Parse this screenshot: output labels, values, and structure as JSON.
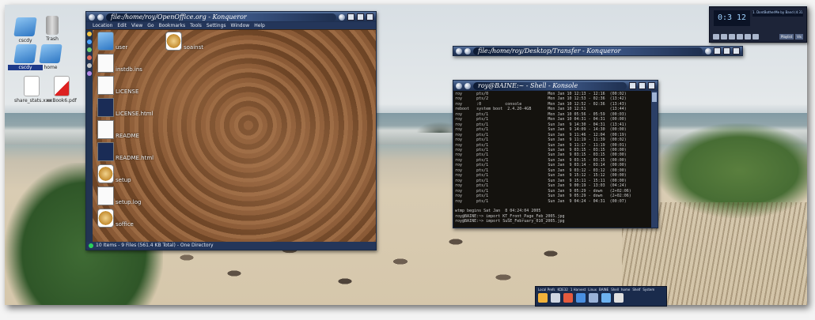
{
  "desktop": {
    "icons": [
      {
        "label": "cscdy",
        "icon": "folder-icon"
      },
      {
        "label": "Trash",
        "icon": "trash-icon"
      },
      {
        "label": "cscdy",
        "icon": "folder-icon"
      },
      {
        "label": "home",
        "icon": "folder-icon"
      },
      {
        "label": "share_stats.xxx",
        "icon": "document-icon"
      },
      {
        "label": "xxBook6.pdf",
        "icon": "pdf-icon"
      }
    ]
  },
  "konqueror_main": {
    "title": "file:/home/roy/OpenOffice.org - Konqueror",
    "menu": [
      "Location",
      "Edit",
      "View",
      "Go",
      "Bookmarks",
      "Tools",
      "Settings",
      "Window",
      "Help"
    ],
    "files": [
      {
        "name": "user",
        "thumb": "folder"
      },
      {
        "name": "soainst",
        "thumb": "tool"
      },
      {
        "name": "instdb.ins",
        "thumb": "doc"
      },
      {
        "name": "LICENSE",
        "thumb": "doc"
      },
      {
        "name": "LICENSE.html",
        "thumb": "dark"
      },
      {
        "name": "README",
        "thumb": "doc"
      },
      {
        "name": "README.html",
        "thumb": "dark"
      },
      {
        "name": "setup",
        "thumb": "tool"
      },
      {
        "name": "setup.log",
        "thumb": "doc"
      },
      {
        "name": "soffice",
        "thumb": "tool"
      }
    ],
    "status": "10 Items - 9 Files (561.4 KB Total) - One Directory"
  },
  "konqueror_second": {
    "title": "file:/home/roy/Desktop/Transfer - Konqueror"
  },
  "konsole": {
    "title": "roy@BAINE:~ - Shell - Konsole",
    "lines": [
      "roy      pts/0                         Mon Jan 10 12:13 - 12:16  (00:02)",
      "roy      pts/2                         Mon Jan 10 12:53 - 02:36  (13:42)",
      "roy      :0          console           Mon Jan 10 12:52 - 02:36  (13:43)",
      "reboot   system boot  2.4.20-4GB       Mon Jan 10 12:51          (13:44)",
      "roy      pts/1                         Mon Jan 10 05:56 - 05:59  (00:03)",
      "roy      pts/1                         Mon Jan 10 04:31 - 04:31  (00:00)",
      "roy      pts/1                         Sun Jan  9 14:30 - 04:31  (13:41)",
      "roy      pts/1                         Sun Jan  9 14:09 - 14:30  (00:00)",
      "roy      pts/1                         Sun Jan  9 11:46 - 12:04  (00:19)",
      "roy      pts/1                         Sun Jan  9 11:19 - 11:39  (00:02)",
      "roy      pts/1                         Sun Jan  9 11:17 - 11:19  (00:01)",
      "roy      pts/1                         Sun Jan  9 03:15 - 03:15  (00:00)",
      "roy      pts/1                         Sun Jan  9 03:15 - 03:15  (00:00)",
      "roy      pts/1                         Sun Jan  9 03:15 - 03:15  (00:00)",
      "roy      pts/1                         Sun Jan  9 03:14 - 03:14  (00:00)",
      "roy      pts/1                         Sun Jan  9 03:12 - 03:12  (00:00)",
      "roy      pts/1                         Sun Jan  9 15:12 - 15:12  (00:00)",
      "roy      pts/1                         Sun Jan  9 15:11 - 15:11  (00:00)",
      "roy      pts/1                         Sun Jan  9 00:19 - 13:03  (04:24)",
      "roy      pts/1                         Sun Jan  9 05:29 - down   (2+02:06)",
      "roy      pts/1                         Sun Jan  9 05:29 - down   (2+02:06)",
      "roy      pts/1                         Sun Jan  9 04:24 - 04:31  (00:07)",
      "",
      "wtmp begins Sat Jan  8 04:24:04 2005",
      "roy@BAINE:~> import KT_Front_Page_Feb_2005.jpg",
      "roy@BAINE:~> import SuSE_February_010_2005.jpg"
    ]
  },
  "player": {
    "time": "0:3 12",
    "track": "1. DontBotherMe by Band (4:31)",
    "extras": [
      "Playlist",
      "Vis"
    ]
  },
  "taskbar": {
    "labels": [
      "Local Prefs",
      "KDE32",
      "1 Harvest",
      "Linux",
      "BAINE",
      "Shell",
      "home",
      "Shelf",
      "System"
    ]
  }
}
